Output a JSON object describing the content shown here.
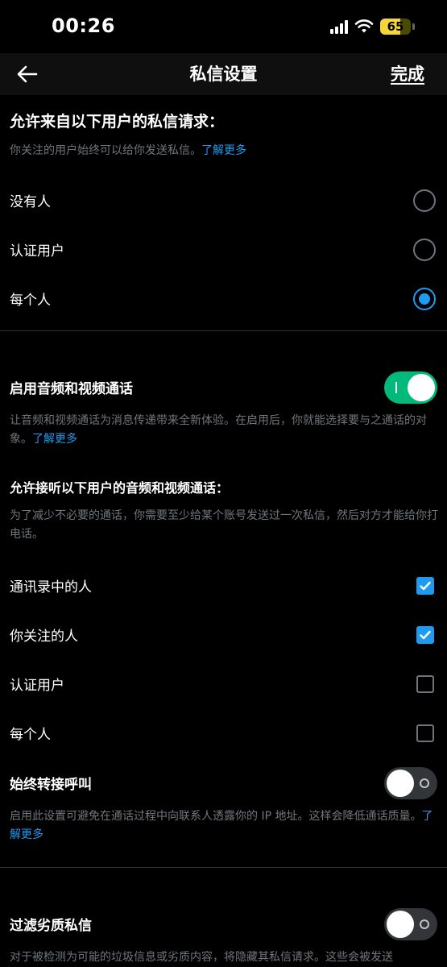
{
  "status": {
    "time": "00:26",
    "battery": "65"
  },
  "nav": {
    "title": "私信设置",
    "done_label": "完成"
  },
  "requests": {
    "heading": "允许来自以下用户的私信请求：",
    "desc": "你关注的用户始终可以给你发送私信。",
    "learn_more": "了解更多",
    "options": [
      {
        "label": "没有人",
        "selected": false
      },
      {
        "label": "认证用户",
        "selected": false
      },
      {
        "label": "每个人",
        "selected": true
      }
    ]
  },
  "calls": {
    "toggle_label": "启用音频和视频通话",
    "enabled": true,
    "toggle_desc": "让音频和视频通话为消息传递带来全新体验。在启用后，你就能选择要与之通话的对象。",
    "learn_more": "了解更多",
    "allow_heading": "允许接听以下用户的音频和视频通话：",
    "allow_desc": "为了减少不必要的通话，你需要至少给某个账号发送过一次私信，然后对方才能给你打电话。",
    "options": [
      {
        "label": "通讯录中的人",
        "checked": true
      },
      {
        "label": "你关注的人",
        "checked": true
      },
      {
        "label": "认证用户",
        "checked": false
      },
      {
        "label": "每个人",
        "checked": false
      }
    ],
    "relay_label": "始终转接呼叫",
    "relay_enabled": false,
    "relay_desc": "启用此设置可避免在通话过程中向联系人透露你的 IP 地址。这样会降低通话质量。",
    "relay_learn_more": "了解更多"
  },
  "filter": {
    "label": "过滤劣质私信",
    "enabled": false,
    "desc": "对于被检测为可能的垃圾信息或劣质内容，将隐藏其私信请求。这些会被发送"
  },
  "colors": {
    "accent": "#1d9bf0",
    "toggle_on": "#00ba7c",
    "background": "#000000"
  }
}
